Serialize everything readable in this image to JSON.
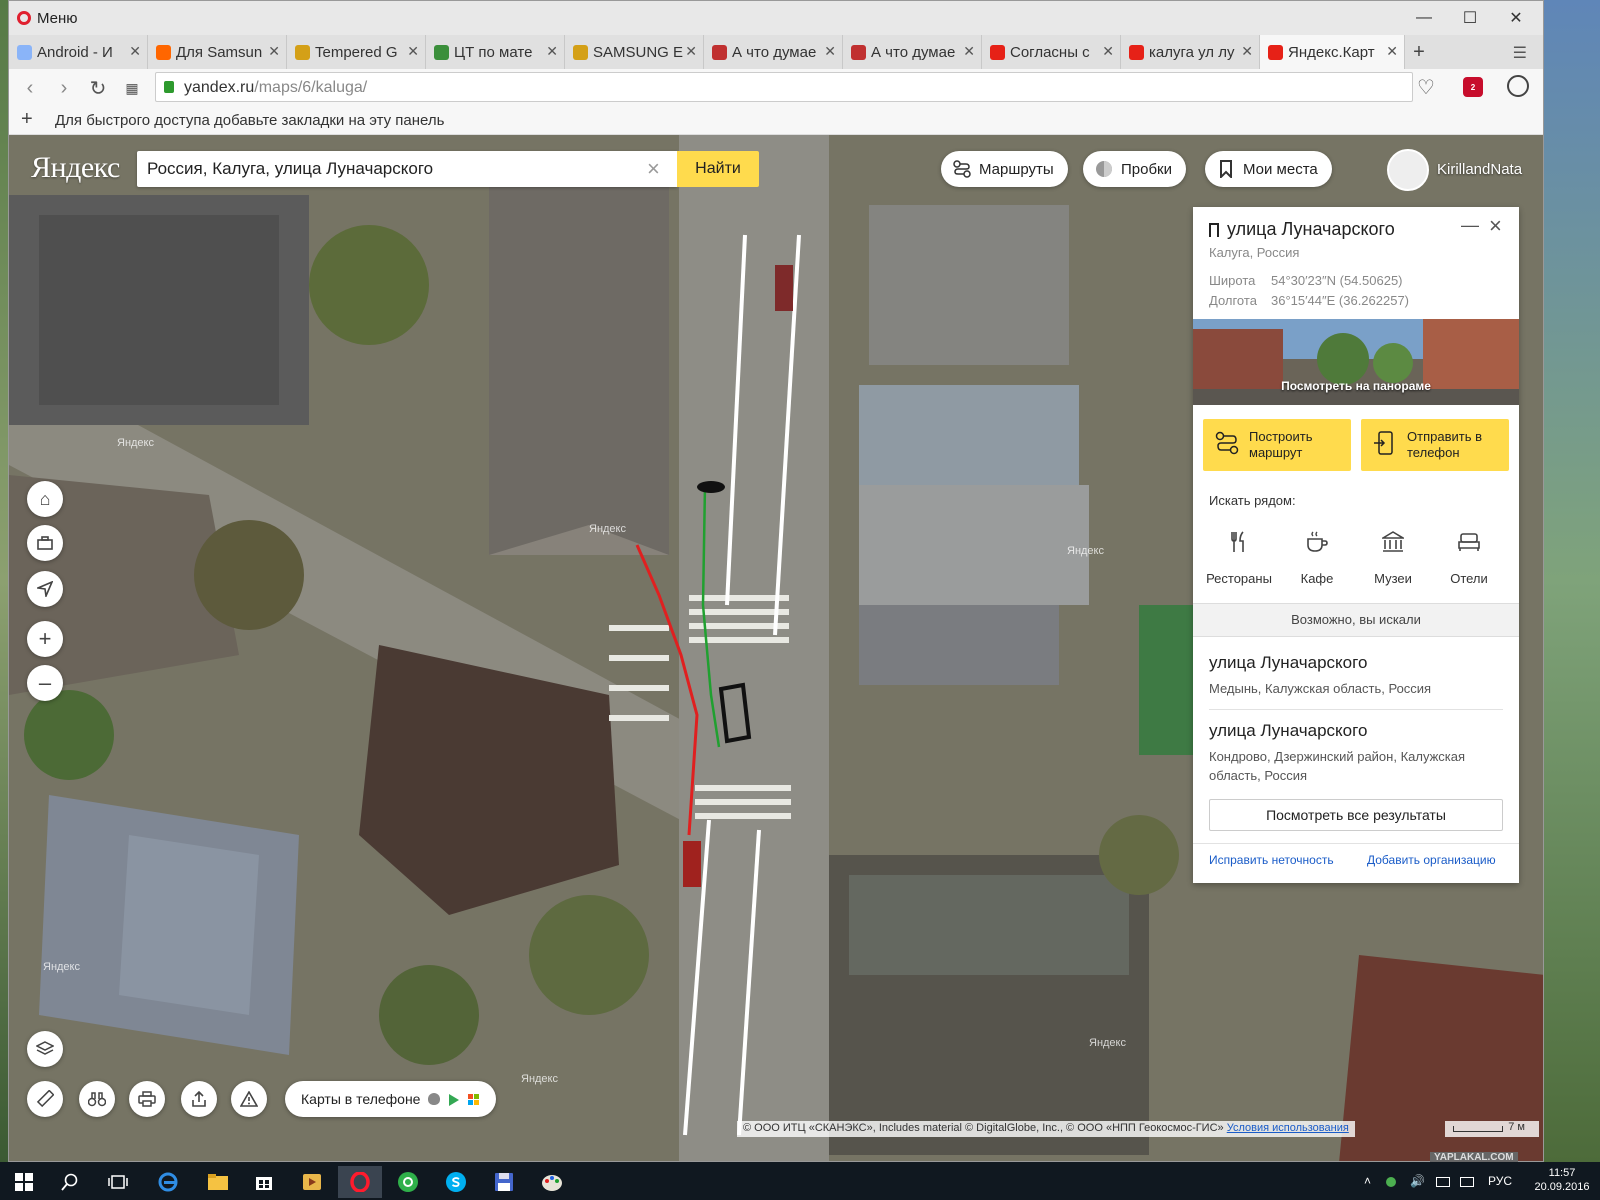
{
  "browser": {
    "menu_label": "Меню",
    "tabs": [
      {
        "label": "Android - И",
        "icon_color": "#8ab4f8"
      },
      {
        "label": "Для Samsun",
        "icon_color": "#ff6600"
      },
      {
        "label": "Tempered G",
        "icon_color": "#d4a017"
      },
      {
        "label": "ЦТ по мате",
        "icon_color": "#3b8f3b"
      },
      {
        "label": "SAMSUNG E",
        "icon_color": "#d4a017"
      },
      {
        "label": "А что думае",
        "icon_color": "#c03030"
      },
      {
        "label": "А что думае",
        "icon_color": "#c03030"
      },
      {
        "label": "Согласны с",
        "icon_color": "#e62117"
      },
      {
        "label": "калуга ул лу",
        "icon_color": "#e62117"
      },
      {
        "label": "Яндекс.Карт",
        "icon_color": "#e62117"
      }
    ],
    "url_domain": "yandex.ru",
    "url_path": "/maps/6/kaluga/",
    "bookmarks_hint": "Для быстрого доступа добавьте закладки на эту панель",
    "abp_badge": "2"
  },
  "yandex": {
    "logo": "Яндекс",
    "search_value": "Россия, Калуга, улица Луначарского",
    "search_button": "Найти",
    "routes_button": "Маршруты",
    "traffic_button": "Пробки",
    "places_button": "Мои места",
    "username": "KirillandNata"
  },
  "card": {
    "title": "улица Луначарского",
    "subtitle": "Калуга, Россия",
    "lat_label": "Широта",
    "lat_value": "54°30′23″N (54.50625)",
    "lon_label": "Долгота",
    "lon_value": "36°15′44″E (36.262257)",
    "panorama_label": "Посмотреть на панораме",
    "route_button": "Построить маршрут",
    "send_button": "Отправить в телефон",
    "nearby_label": "Искать рядом:",
    "categories": [
      "Рестораны",
      "Кафе",
      "Музеи",
      "Отели"
    ],
    "maybe_label": "Возможно, вы искали",
    "results": [
      {
        "title": "улица Луначарского",
        "sub": "Медынь, Калужская область, Россия"
      },
      {
        "title": "улица Луначарского",
        "sub": "Кондрово, Дзержинский район, Калужская область, Россия"
      }
    ],
    "all_results": "Посмотреть все результаты",
    "fix_link": "Исправить неточность",
    "add_org_link": "Добавить организацию"
  },
  "map": {
    "watermark": "Яндекс",
    "phone_pill": "Карты в телефоне",
    "copyright_text": "© ООО ИТЦ «СКАНЭКС», Includes material © DigitalGlobe, Inc., © ООО «НПП Геокосмос-ГИС»",
    "terms_link": "Условия использования",
    "scale_label": "7 м"
  },
  "taskbar": {
    "lang": "РУС",
    "time": "11:57",
    "date": "20.09.2016"
  },
  "watermark_site": "YAPLAKAL.COM"
}
